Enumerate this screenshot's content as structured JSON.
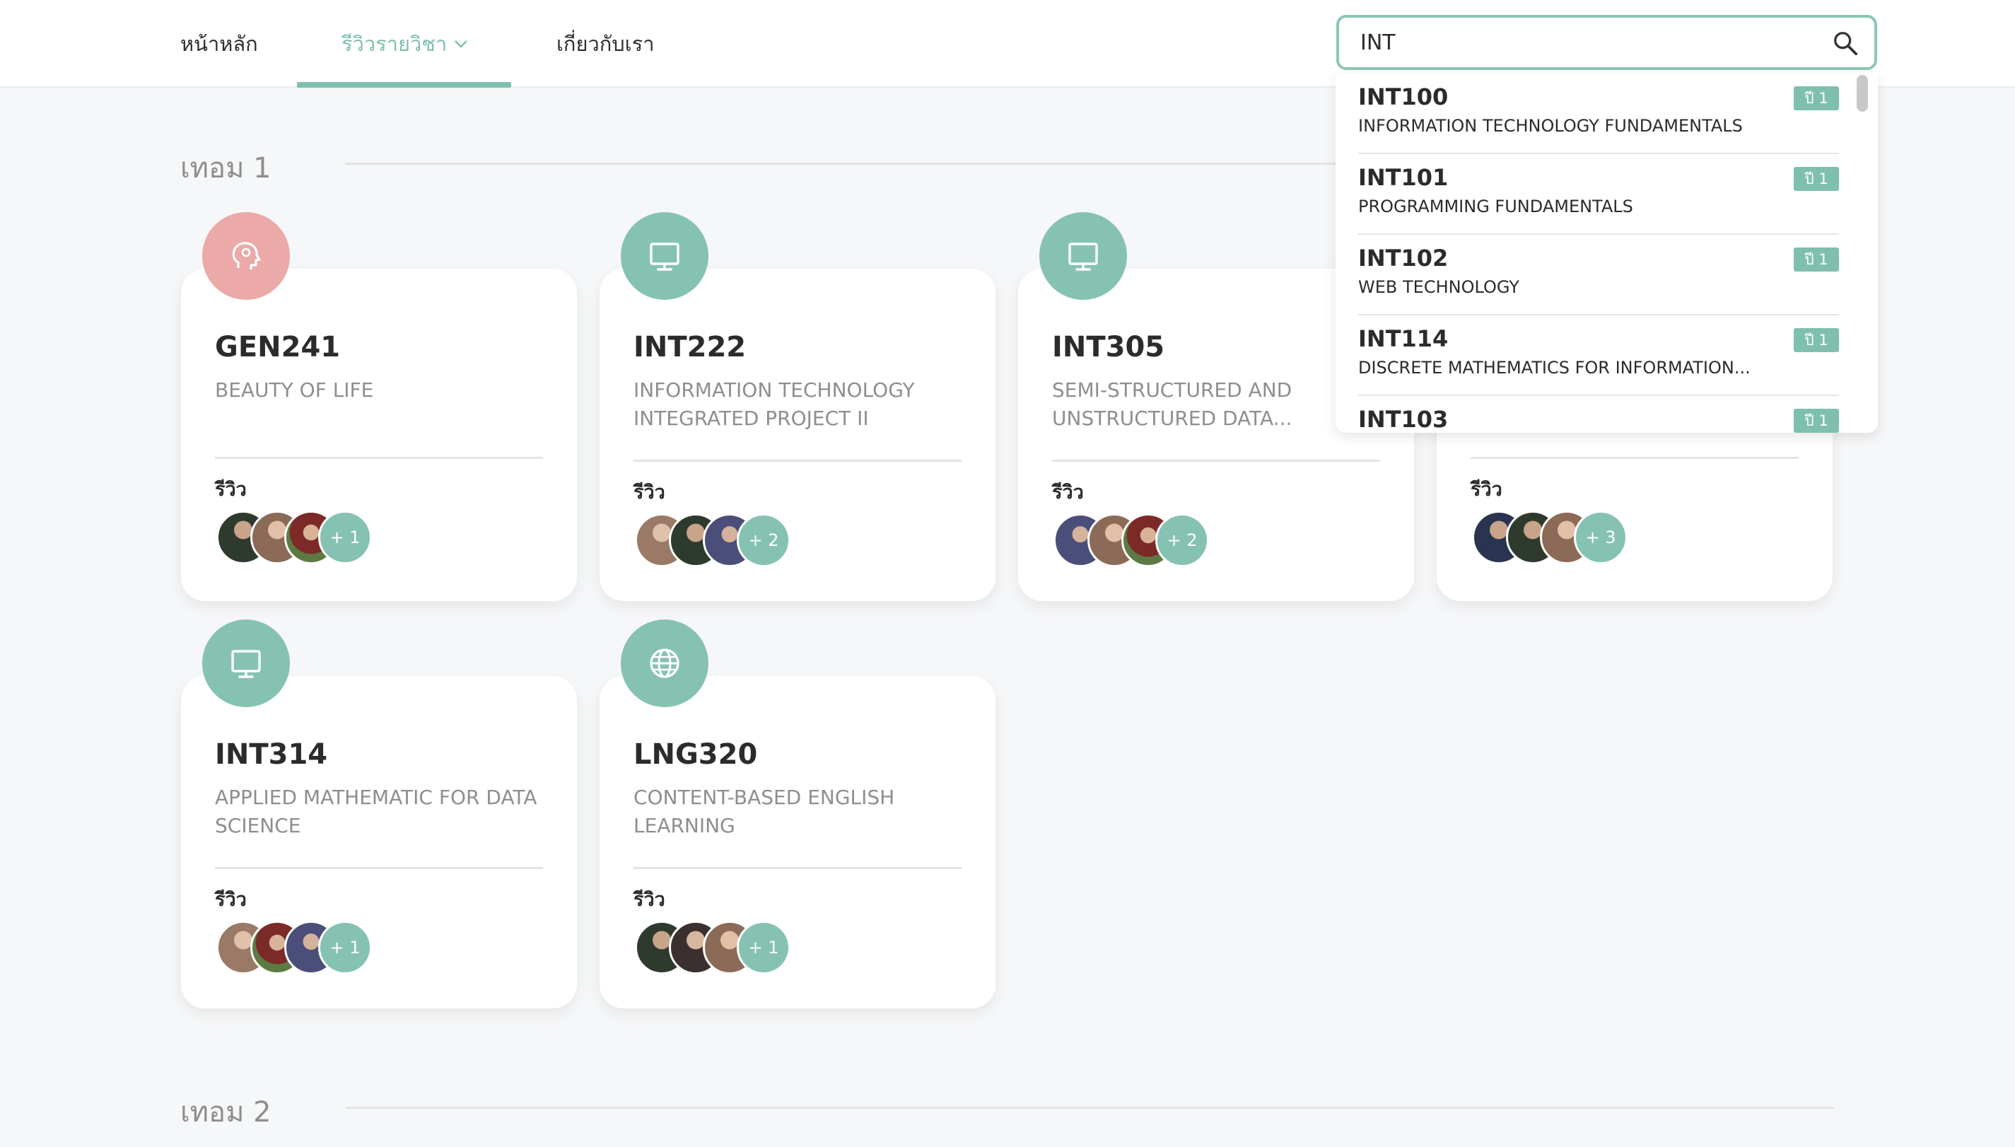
{
  "nav": {
    "home": "หน้าหลัก",
    "reviews": "รีวิวรายวิชา",
    "about": "เกี่ยวกับเรา"
  },
  "search": {
    "value": "INT",
    "results": [
      {
        "code": "INT100",
        "name": "INFORMATION TECHNOLOGY FUNDAMENTALS",
        "badge": "ปี 1"
      },
      {
        "code": "INT101",
        "name": "PROGRAMMING FUNDAMENTALS",
        "badge": "ปี 1"
      },
      {
        "code": "INT102",
        "name": "WEB TECHNOLOGY",
        "badge": "ปี 1"
      },
      {
        "code": "INT114",
        "name": "DISCRETE MATHEMATICS FOR INFORMATION...",
        "badge": "ปี 1"
      },
      {
        "code": "INT103",
        "name": "",
        "badge": "ปี 1"
      }
    ]
  },
  "sections": {
    "term1": "เทอม 1",
    "term2": "เทอม 2"
  },
  "cards": [
    {
      "code": "GEN241",
      "name": "BEAUTY OF LIFE",
      "review_label": "รีวิว",
      "more": "+ 1",
      "icon": "brain-icon"
    },
    {
      "code": "INT222",
      "name": "INFORMATION TECHNOLOGY INTEGRATED PROJECT II",
      "review_label": "รีวิว",
      "more": "+ 2",
      "icon": "monitor-icon"
    },
    {
      "code": "INT305",
      "name": "SEMI-STRUCTURED AND UNSTRUCTURED DATA...",
      "review_label": "รีวิว",
      "more": "+ 2",
      "icon": "monitor-icon"
    },
    {
      "code": "",
      "name": "",
      "review_label": "รีวิว",
      "more": "+ 3",
      "icon": ""
    },
    {
      "code": "INT314",
      "name": "APPLIED MATHEMATIC FOR DATA SCIENCE",
      "review_label": "รีวิว",
      "more": "+ 1",
      "icon": "monitor-icon"
    },
    {
      "code": "LNG320",
      "name": "CONTENT-BASED ENGLISH LEARNING",
      "review_label": "รีวิว",
      "more": "+ 1",
      "icon": "globe-icon"
    }
  ],
  "colors": {
    "accent": "#7fbfae",
    "pink": "#eba9a7"
  }
}
